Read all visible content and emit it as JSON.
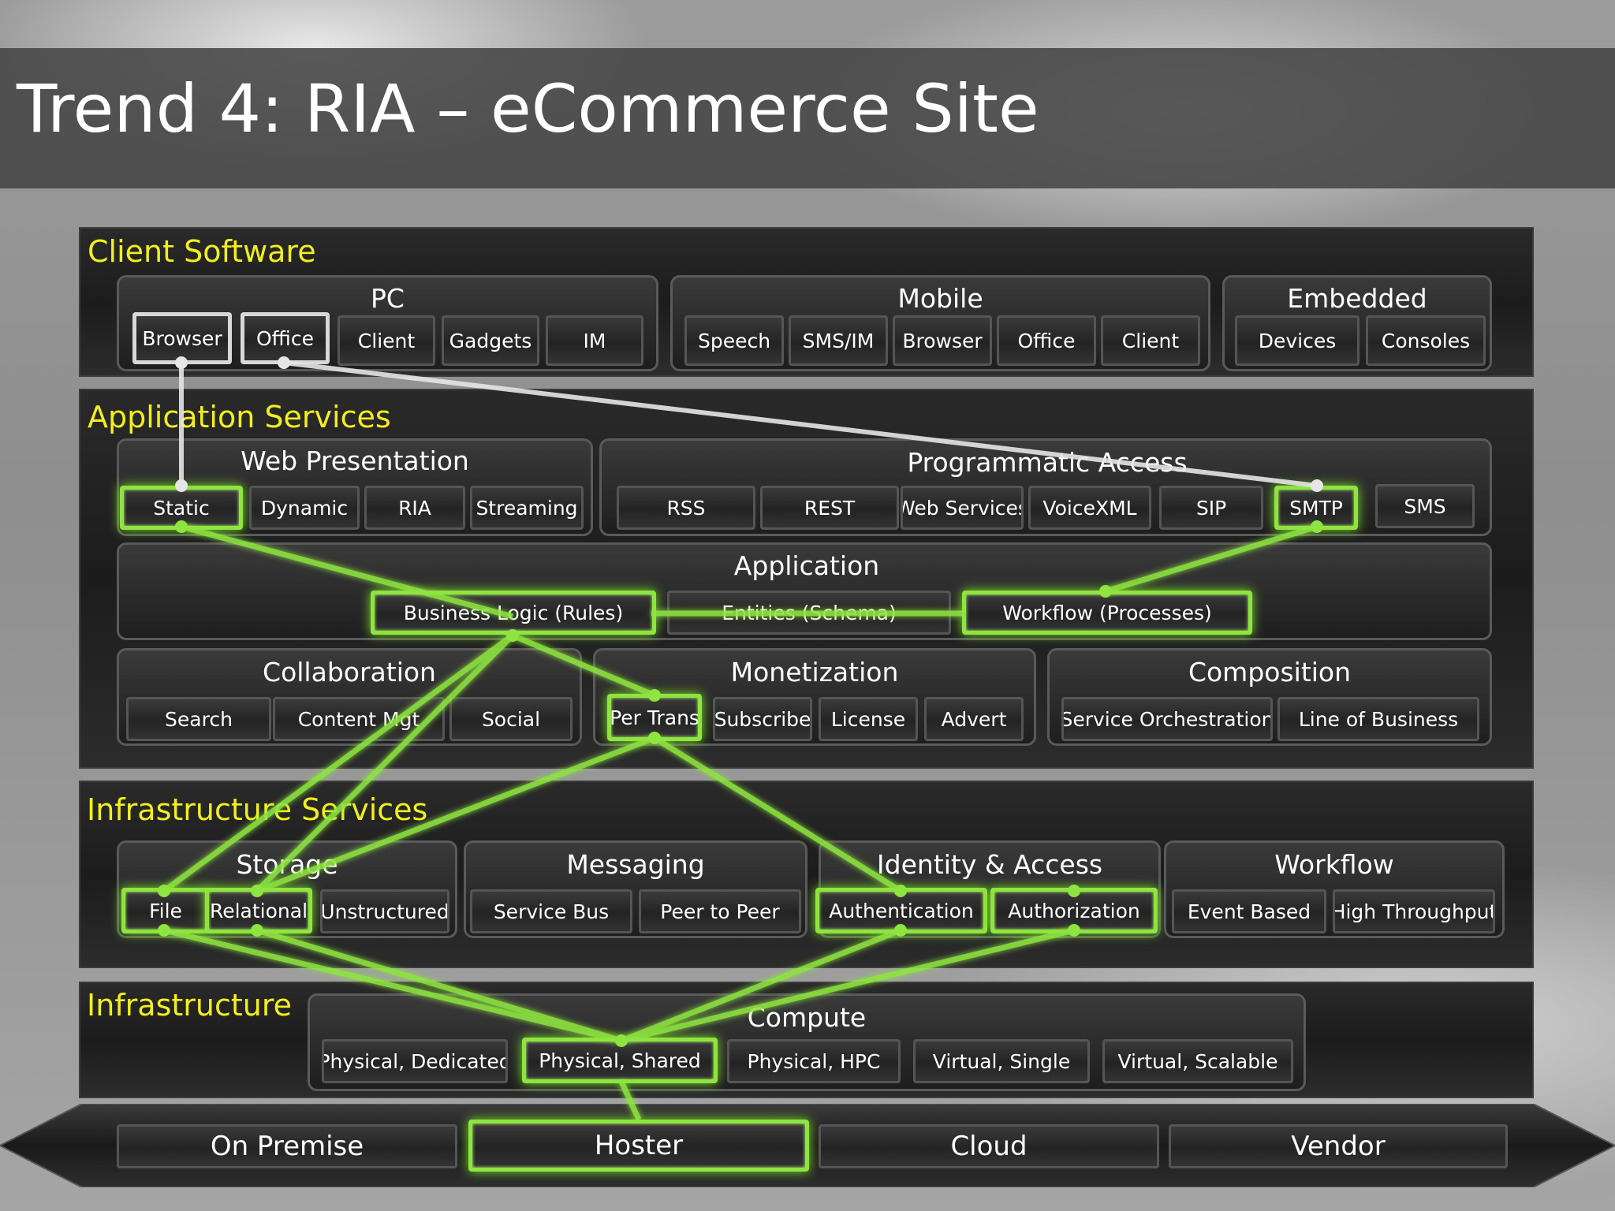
{
  "title": "Trend 4: RIA – eCommerce Site",
  "layers": {
    "client": {
      "title": "Client Software",
      "pc": {
        "title": "PC",
        "items": [
          "Browser",
          "Office",
          "Client",
          "Gadgets",
          "IM"
        ]
      },
      "mobile": {
        "title": "Mobile",
        "items": [
          "Speech",
          "SMS/IM",
          "Browser",
          "Office",
          "Client"
        ]
      },
      "embedded": {
        "title": "Embedded",
        "items": [
          "Devices",
          "Consoles"
        ]
      }
    },
    "app": {
      "title": "Application Services",
      "web": {
        "title": "Web Presentation",
        "items": [
          "Static",
          "Dynamic",
          "RIA",
          "Streaming"
        ]
      },
      "prog": {
        "title": "Programmatic Access",
        "items": [
          "RSS",
          "REST",
          "Web Services",
          "VoiceXML",
          "SIP",
          "SMTP",
          "SMS"
        ]
      },
      "application": {
        "title": "Application",
        "items": [
          "Business Logic (Rules)",
          "Entities (Schema)",
          "Workflow (Processes)"
        ]
      },
      "collab": {
        "title": "Collaboration",
        "items": [
          "Search",
          "Content Mgt",
          "Social"
        ]
      },
      "monet": {
        "title": "Monetization",
        "items": [
          "Per Trans",
          "Subscribe",
          "License",
          "Advert"
        ]
      },
      "compo": {
        "title": "Composition",
        "items": [
          "Service Orchestration",
          "Line of Business"
        ]
      }
    },
    "infra_services": {
      "title": "Infrastructure Services",
      "storage": {
        "title": "Storage",
        "items": [
          "File",
          "Relational",
          "Unstructured"
        ]
      },
      "messaging": {
        "title": "Messaging",
        "items": [
          "Service Bus",
          "Peer to Peer"
        ]
      },
      "identity": {
        "title": "Identity & Access",
        "items": [
          "Authentication",
          "Authorization"
        ]
      },
      "workflow": {
        "title": "Workflow",
        "items": [
          "Event Based",
          "High Throughput"
        ]
      }
    },
    "infra": {
      "title": "Infrastructure",
      "compute": {
        "title": "Compute",
        "items": [
          "Physical, Dedicated",
          "Physical, Shared",
          "Physical, HPC",
          "Virtual, Single",
          "Virtual, Scalable"
        ]
      }
    },
    "hosting": {
      "items": [
        "On Premise",
        "Hoster",
        "Cloud",
        "Vendor"
      ]
    }
  },
  "colors": {
    "highlight": "#8ee53f",
    "link_white": "#e6e6e6",
    "layer_title": "#f2ef1e",
    "band": "#222222"
  }
}
